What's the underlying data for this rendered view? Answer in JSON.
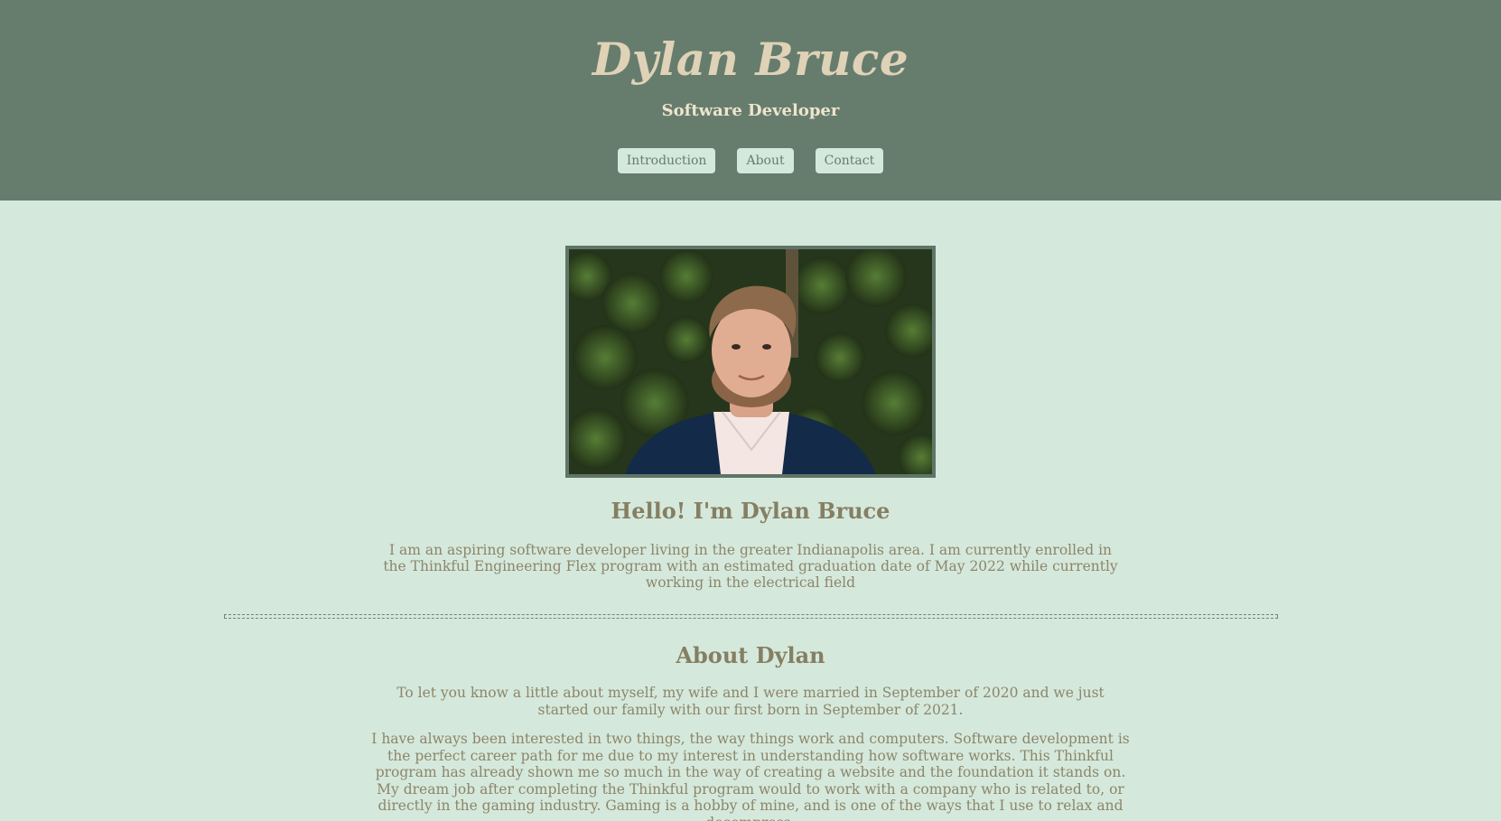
{
  "header": {
    "title": "Dylan Bruce",
    "subtitle": "Software Developer",
    "nav": [
      {
        "label": "Introduction"
      },
      {
        "label": "About"
      },
      {
        "label": "Contact"
      }
    ]
  },
  "intro": {
    "photo_alt": "Portrait photo of Dylan Bruce",
    "heading": "Hello! I'm Dylan Bruce",
    "text": "I am an aspiring software developer living in the greater Indianapolis area. I am currently enrolled in the Thinkful Engineering Flex program with an estimated graduation date of May 2022 while currently working in the electrical field"
  },
  "about": {
    "heading": "About Dylan",
    "paragraphs": [
      "To let you know a little about myself, my wife and I were married in September of 2020 and we just started our family with our first born in September of 2021.",
      "I have always been interested in two things, the way things work and computers. Software development is the perfect career path for me due to my interest in understanding how software works. This Thinkful program has already shown me so much in the way of creating a website and the foundation it stands on. My dream job after completing the Thinkful program would to work with a company who is related to, or directly in the gaming industry. Gaming is a hobby of mine, and is one of the ways that I use to relax and decompress."
    ]
  },
  "colors": {
    "header_bg": "#667d6e",
    "page_bg": "#d5e8dc",
    "title": "#dfd2b6",
    "body_text": "#8c8669"
  }
}
